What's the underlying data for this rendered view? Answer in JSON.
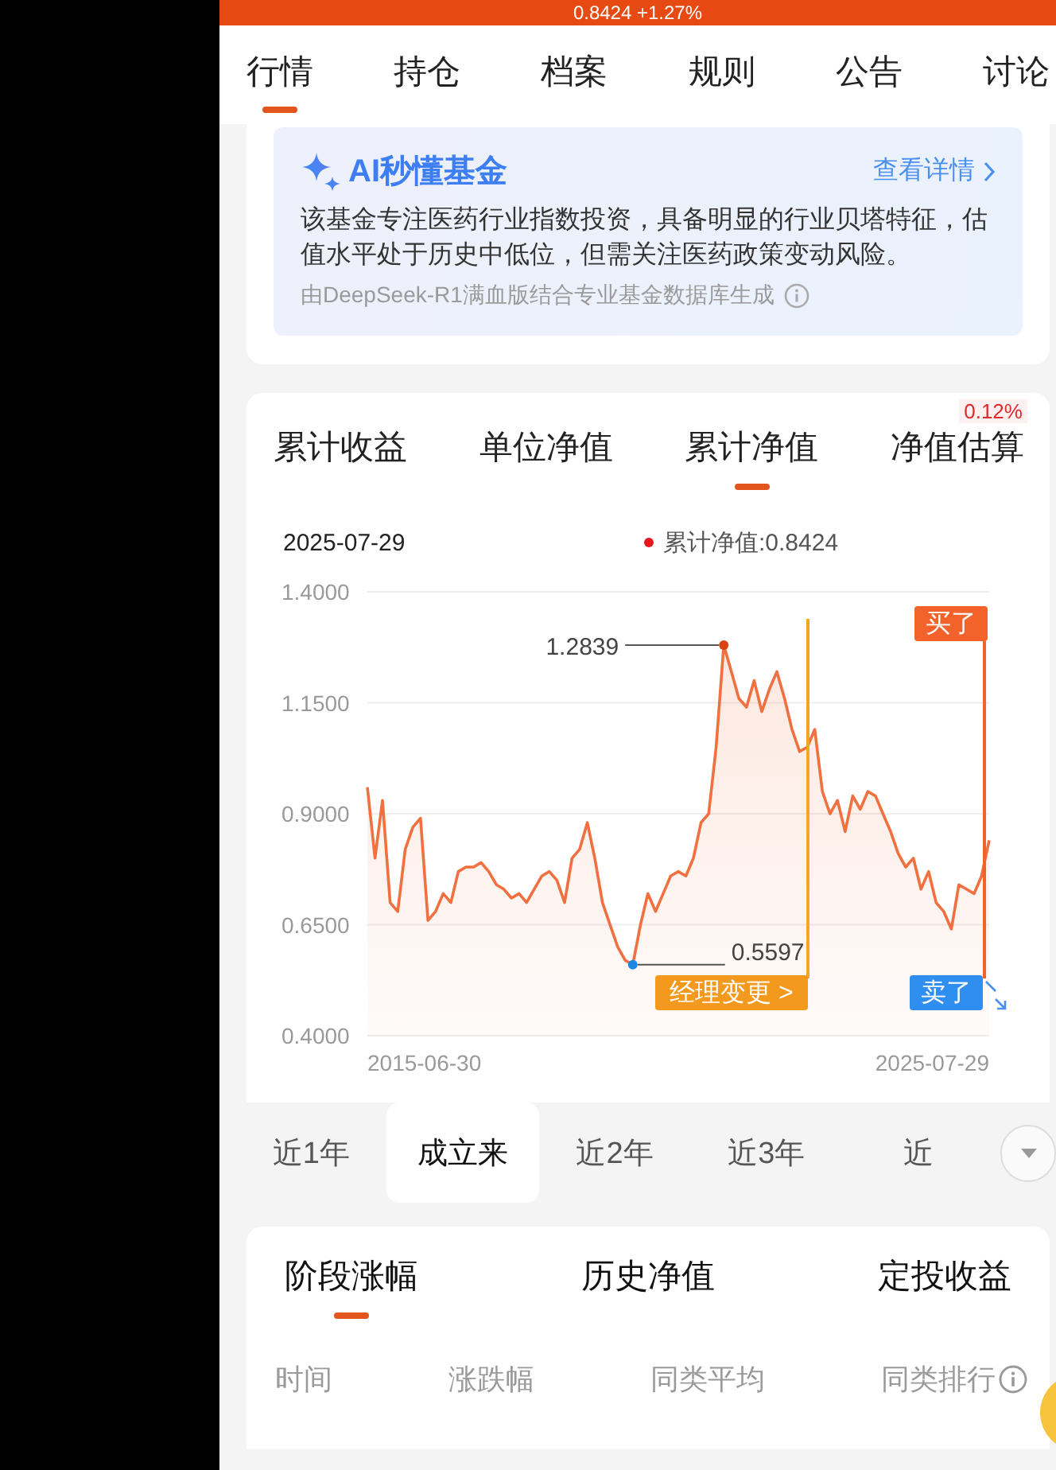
{
  "header": {
    "price_change": "0.8424 +1.27%"
  },
  "tabs": [
    {
      "label": "行情",
      "selected": true
    },
    {
      "label": "持仓",
      "selected": false
    },
    {
      "label": "档案",
      "selected": false
    },
    {
      "label": "规则",
      "selected": false
    },
    {
      "label": "公告",
      "selected": false
    },
    {
      "label": "讨论",
      "selected": false
    }
  ],
  "ai_summary": {
    "title": "AI秒懂基金",
    "link": "查看详情",
    "text": "该基金专注医药行业指数投资，具备明显的行业贝塔特征，估值水平处于历史中低位，但需关注医药政策变动风险。",
    "footnote": "由DeepSeek-R1满血版结合专业基金数据库生成"
  },
  "chart_tabs": [
    {
      "label": "累计收益",
      "selected": false
    },
    {
      "label": "单位净值",
      "selected": false
    },
    {
      "label": "累计净值",
      "selected": true
    },
    {
      "label": "净值估算",
      "selected": false,
      "badge": "0.12%"
    }
  ],
  "chart_legend": {
    "date": "2025-07-29",
    "label": "累计净值:0.8424",
    "color": "#e8141e"
  },
  "chart_data": {
    "type": "area",
    "color": "#f07040",
    "grid": true,
    "values": [
      0.96,
      0.8,
      0.93,
      0.7,
      0.68,
      0.82,
      0.87,
      0.89,
      0.66,
      0.68,
      0.72,
      0.7,
      0.77,
      0.78,
      0.78,
      0.79,
      0.77,
      0.74,
      0.73,
      0.71,
      0.72,
      0.7,
      0.73,
      0.76,
      0.77,
      0.75,
      0.7,
      0.8,
      0.82,
      0.88,
      0.8,
      0.7,
      0.65,
      0.6,
      0.57,
      0.56,
      0.65,
      0.72,
      0.68,
      0.72,
      0.76,
      0.77,
      0.76,
      0.8,
      0.88,
      0.9,
      1.05,
      1.28,
      1.22,
      1.16,
      1.14,
      1.2,
      1.13,
      1.18,
      1.22,
      1.16,
      1.09,
      1.04,
      1.05,
      1.09,
      0.95,
      0.9,
      0.93,
      0.86,
      0.94,
      0.91,
      0.95,
      0.94,
      0.9,
      0.86,
      0.81,
      0.78,
      0.8,
      0.73,
      0.77,
      0.7,
      0.68,
      0.64,
      0.74,
      0.73,
      0.72,
      0.76,
      0.84
    ],
    "ylim": [
      0.4,
      1.4
    ],
    "yticks": [
      {
        "value": 1.4,
        "label": "1.4000"
      },
      {
        "value": 1.15,
        "label": "1.1500"
      },
      {
        "value": 0.9,
        "label": "0.9000"
      },
      {
        "value": 0.65,
        "label": "0.6500"
      },
      {
        "value": 0.4,
        "label": "0.4000"
      }
    ],
    "annotations": [
      "1.2839",
      "0.5597"
    ]
  },
  "chart_axis": {
    "start": "2015-06-30",
    "end": "2025-07-29"
  },
  "chart_markers": [
    {
      "kind": "event",
      "text": "经理变更 >"
    },
    {
      "kind": "buy",
      "text": "买了"
    },
    {
      "kind": "sell",
      "text": "卖了"
    }
  ],
  "ranges": [
    {
      "label": "近1年",
      "selected": false
    },
    {
      "label": "成立来",
      "selected": true
    },
    {
      "label": "近2年",
      "selected": false
    },
    {
      "label": "近3年",
      "selected": false
    },
    {
      "label": "近",
      "selected": false
    }
  ],
  "stats_tabs": [
    {
      "label": "阶段涨幅",
      "selected": true
    },
    {
      "label": "历史净值",
      "selected": false
    },
    {
      "label": "定投收益",
      "selected": false
    }
  ],
  "stats_columns": [
    {
      "label": "时间"
    },
    {
      "label": "涨跌幅"
    },
    {
      "label": "同类平均"
    },
    {
      "label": "同类排行",
      "info": true
    }
  ]
}
